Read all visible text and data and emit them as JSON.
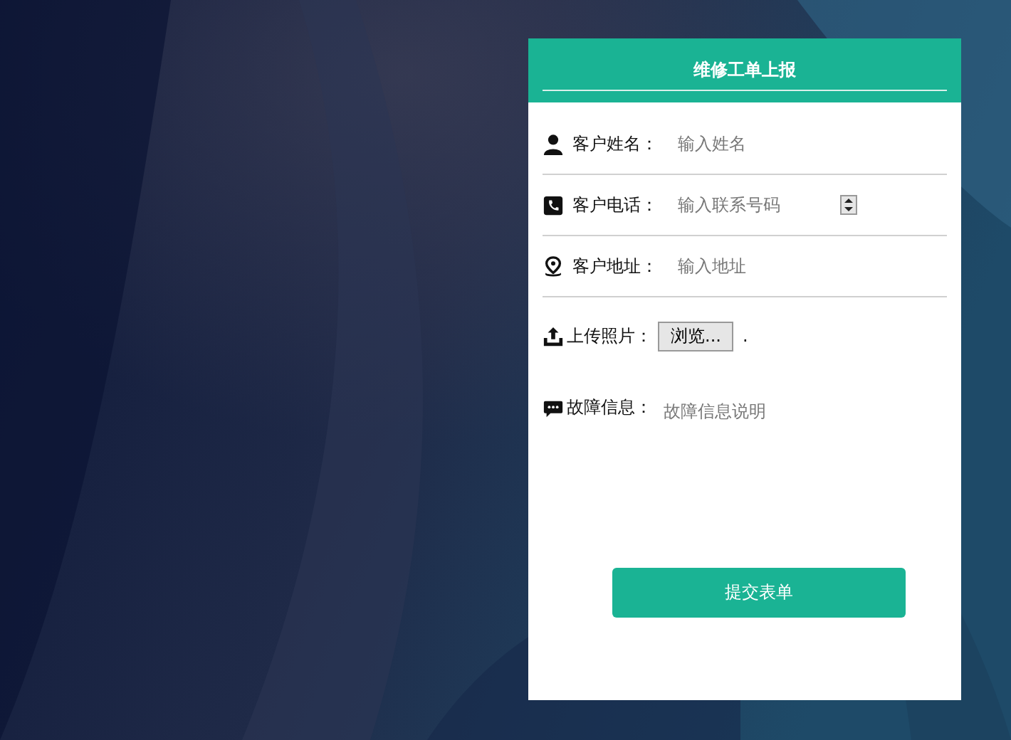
{
  "form": {
    "title": "维修工单上报",
    "fields": [
      {
        "kind": "name",
        "label": "客户姓名：",
        "placeholder": "输入姓名"
      },
      {
        "kind": "phone",
        "label": "客户电话：",
        "placeholder": "输入联系号码"
      },
      {
        "kind": "address",
        "label": "客户地址：",
        "placeholder": "输入地址"
      },
      {
        "kind": "upload",
        "label": "上传照片：",
        "button": "浏览...",
        "status": "."
      },
      {
        "kind": "message",
        "label": "故障信息：",
        "placeholder": "故障信息说明"
      }
    ],
    "submit": "提交表单"
  }
}
